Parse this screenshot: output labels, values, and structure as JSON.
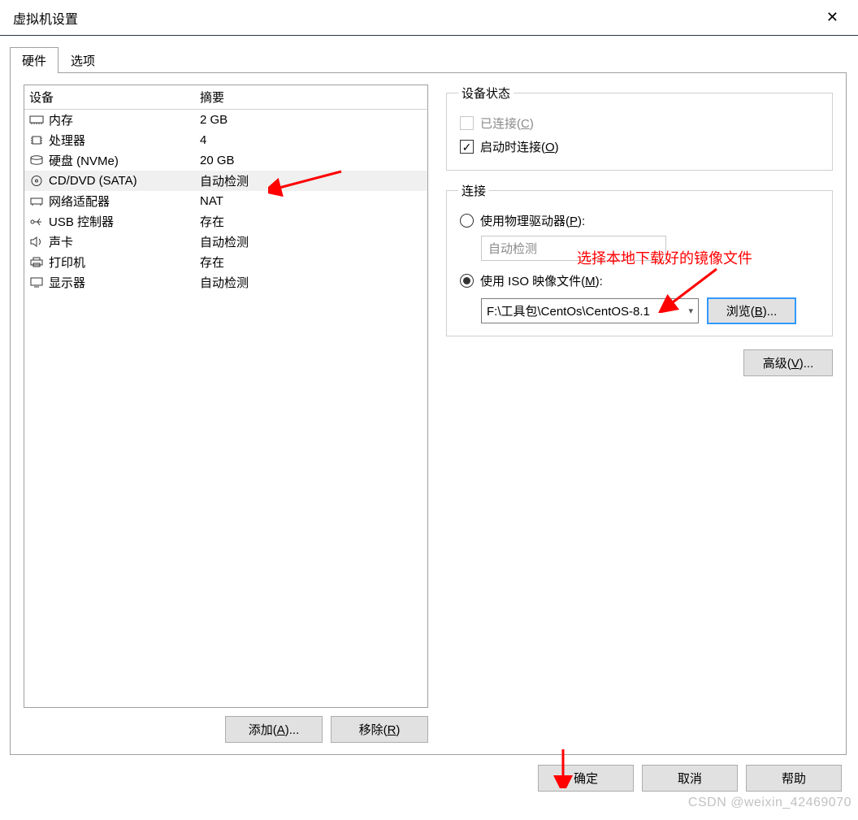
{
  "window": {
    "title": "虚拟机设置"
  },
  "tabs": {
    "hardware": "硬件",
    "options": "选项"
  },
  "device_list": {
    "header_device": "设备",
    "header_summary": "摘要",
    "rows": [
      {
        "name": "内存",
        "summary": "2 GB"
      },
      {
        "name": "处理器",
        "summary": "4"
      },
      {
        "name": "硬盘 (NVMe)",
        "summary": "20 GB"
      },
      {
        "name": "CD/DVD (SATA)",
        "summary": "自动检测"
      },
      {
        "name": "网络适配器",
        "summary": "NAT"
      },
      {
        "name": "USB 控制器",
        "summary": "存在"
      },
      {
        "name": "声卡",
        "summary": "自动检测"
      },
      {
        "name": "打印机",
        "summary": "存在"
      },
      {
        "name": "显示器",
        "summary": "自动检测"
      }
    ]
  },
  "buttons": {
    "add_pre": "添加(",
    "add_u": "A",
    "add_post": ")...",
    "remove_pre": "移除(",
    "remove_u": "R",
    "remove_post": ")",
    "browse_pre": "浏览(",
    "browse_u": "B",
    "browse_post": ")...",
    "advanced_pre": "高级(",
    "advanced_u": "V",
    "advanced_post": ")...",
    "ok": "确定",
    "cancel": "取消",
    "help": "帮助"
  },
  "device_state": {
    "legend": "设备状态",
    "connected_pre": "已连接(",
    "connected_u": "C",
    "connected_post": ")",
    "connect_on_power_pre": "启动时连接(",
    "connect_on_power_u": "O",
    "connect_on_power_post": ")"
  },
  "connection": {
    "legend": "连接",
    "use_physical_pre": "使用物理驱动器(",
    "use_physical_u": "P",
    "use_physical_post": "):",
    "physical_value": "自动检测",
    "use_iso_pre": "使用 ISO 映像文件(",
    "use_iso_u": "M",
    "use_iso_post": "):",
    "iso_path": "F:\\工具包\\CentOs\\CentOS-8.1"
  },
  "annotation": {
    "red_text": "选择本地下载好的镜像文件"
  },
  "watermark": "CSDN @weixin_42469070"
}
